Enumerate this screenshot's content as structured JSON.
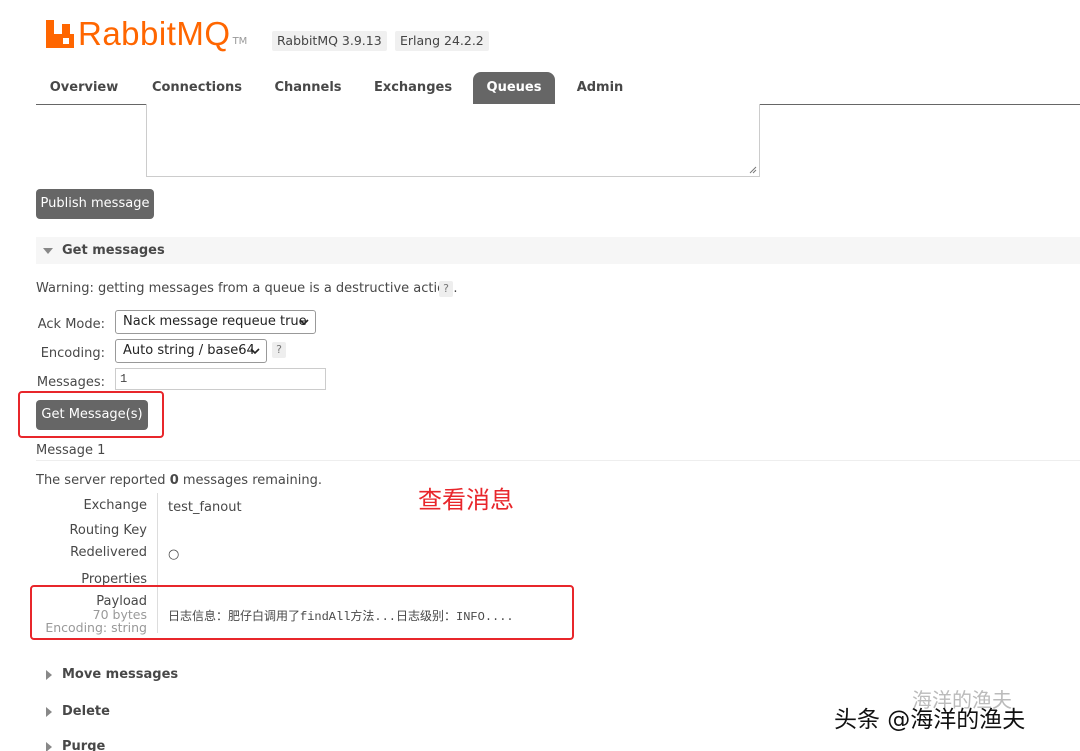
{
  "header": {
    "logo_text": "RabbitMQ",
    "logo_tm": "TM",
    "version_badge": "RabbitMQ 3.9.13",
    "erlang_badge": "Erlang 24.2.2",
    "brand_color": "#ff6600"
  },
  "tabs": [
    {
      "label": "Overview",
      "active": false
    },
    {
      "label": "Connections",
      "active": false
    },
    {
      "label": "Channels",
      "active": false
    },
    {
      "label": "Exchanges",
      "active": false
    },
    {
      "label": "Queues",
      "active": true
    },
    {
      "label": "Admin",
      "active": false
    }
  ],
  "publish": {
    "payload_value": "",
    "button_label": "Publish message"
  },
  "get_messages": {
    "title": "Get messages",
    "warning": "Warning: getting messages from a queue is a destructive action.",
    "help_label": "?",
    "ack_mode_label": "Ack Mode:",
    "ack_mode_value": "Nack message requeue true",
    "encoding_label": "Encoding:",
    "encoding_value": "Auto string / base64",
    "messages_label": "Messages:",
    "messages_value": "1",
    "button_label": "Get Message(s)"
  },
  "result": {
    "message_heading": "Message 1",
    "server_prefix": "The server reported ",
    "remaining_count": "0",
    "server_suffix": " messages remaining.",
    "annotation": "查看消息",
    "fields": {
      "exchange_label": "Exchange",
      "exchange_value": "test_fanout",
      "routing_key_label": "Routing Key",
      "routing_key_value": "",
      "redelivered_label": "Redelivered",
      "redelivered_value": "○",
      "properties_label": "Properties",
      "payload_label": "Payload",
      "payload_size": "70 bytes",
      "payload_encoding": "Encoding: string",
      "payload_value": "日志信息：肥仔白调用了findAll方法...日志级别：INFO...."
    }
  },
  "sections": {
    "move": "Move messages",
    "delete": "Delete",
    "purge": "Purge"
  },
  "watermark": {
    "main": "头条 @海洋的渔夫",
    "faint": "海洋的渔夫"
  },
  "colors": {
    "highlight_red": "#e8262b",
    "button_gray": "#666666"
  }
}
